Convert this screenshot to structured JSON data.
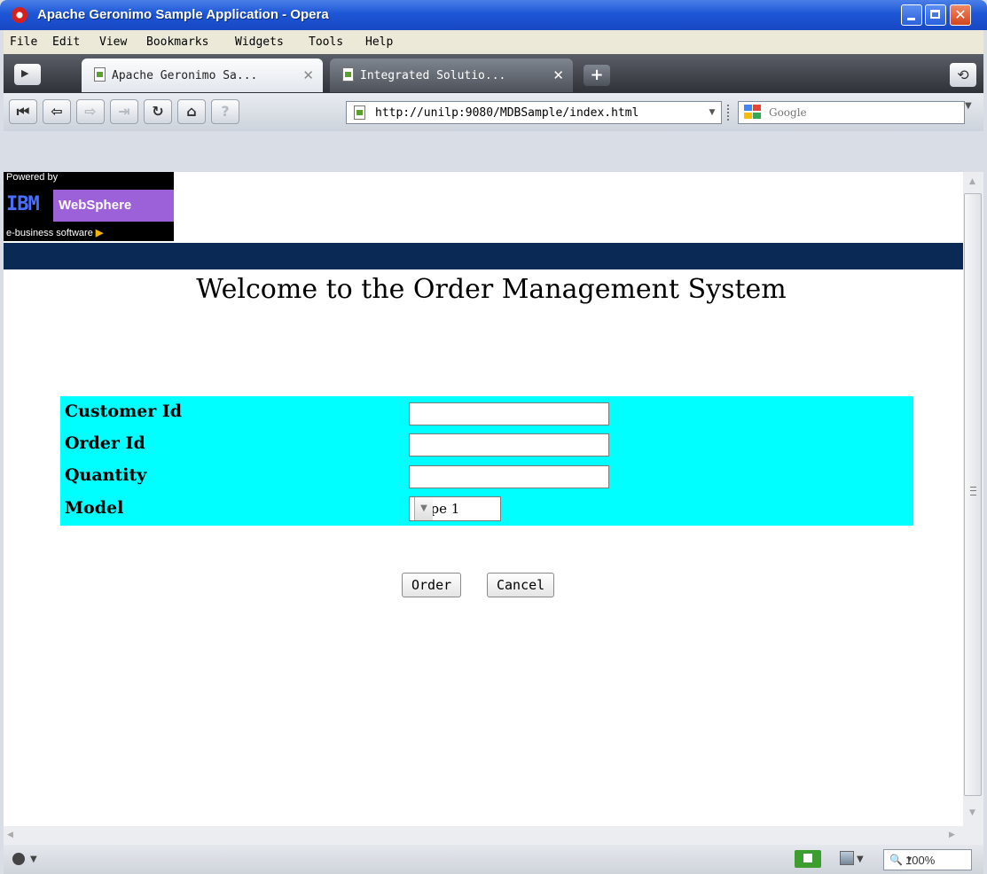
{
  "window": {
    "title": "Apache Geronimo Sample Application - Opera",
    "close_glyph": "✕"
  },
  "menu": [
    "File",
    "Edit",
    "View",
    "Bookmarks",
    "Widgets",
    "Tools",
    "Help"
  ],
  "tabs": [
    {
      "label": "Apache Geronimo Sa...",
      "active": true
    },
    {
      "label": "Integrated Solutio...",
      "active": false
    }
  ],
  "tab_close_glyph": "✕",
  "new_tab_glyph": "+",
  "trash_glyph": "⟲",
  "nav": {
    "rewind": "⏮",
    "back": "⇦",
    "forward": "⇨",
    "fast_forward": "⇥",
    "reload": "↻",
    "home": "⌂",
    "wand": "?"
  },
  "address": {
    "url": "http://unilp:9080/MDBSample/index.html"
  },
  "search": {
    "placeholder": "Google"
  },
  "banner": {
    "powered_by": "Powered by",
    "ibm": "IBM",
    "websphere": "WebSphere",
    "ebusiness": "e-business software",
    "ebusiness_arrow": "▶"
  },
  "page": {
    "title": "Welcome to the Order Management System"
  },
  "form": {
    "customer_id_label": "Customer Id",
    "order_id_label": "Order Id",
    "quantity_label": "Quantity",
    "model_label": "Model",
    "customer_id_value": "",
    "order_id_value": "",
    "quantity_value": "",
    "model_value": "Type 1",
    "order_button": "Order",
    "cancel_button": "Cancel"
  },
  "status": {
    "zoom": "100%"
  },
  "colors": {
    "form_background": "#00ffff",
    "header_bar": "#0a2a55",
    "title_bar": "#1d56d6"
  }
}
